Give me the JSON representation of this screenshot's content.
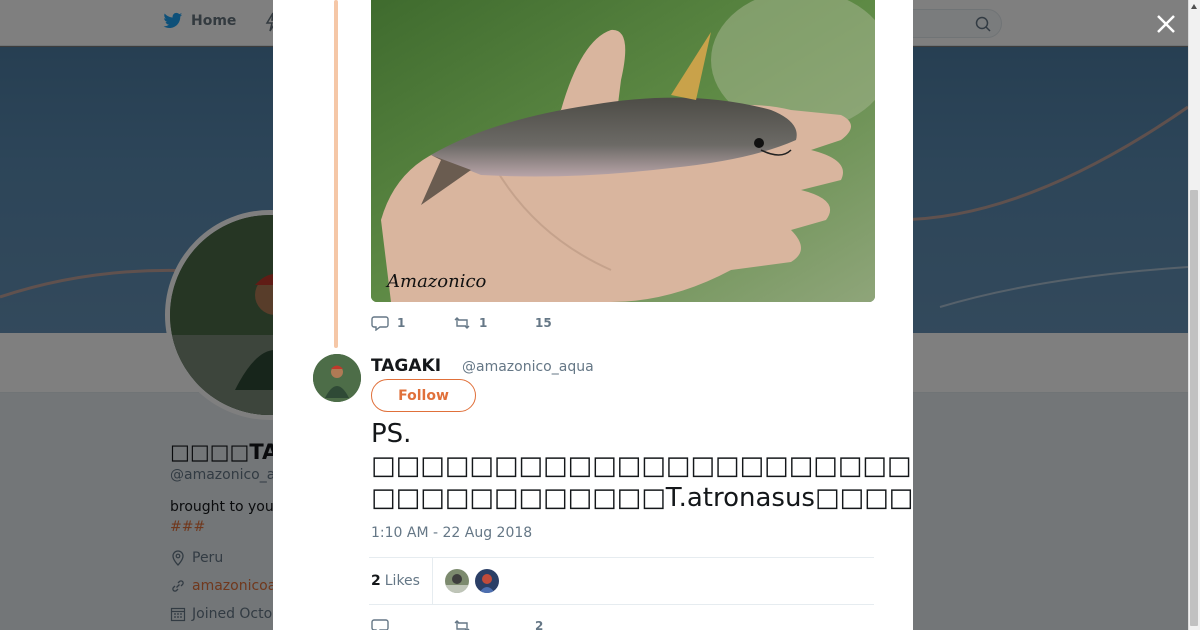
{
  "nav": {
    "home_label": "Home",
    "search_placeholder": ""
  },
  "profile": {
    "display_name": "□□□□TAGA",
    "handle": "@amazonico_a",
    "bio": "brought to you",
    "hashtags": "###",
    "location": "Peru",
    "website": "amazonicoa",
    "joined": "Joined Octo"
  },
  "tweet": {
    "previous_actions": {
      "replies": "1",
      "retweets": "1",
      "likes": "15"
    },
    "author_name": "TAGAKI",
    "author_handle": "@amazonico_aqua",
    "follow_label": "Follow",
    "photo_watermark": "Amazonico",
    "text_lines": [
      "PS.",
      "□□□□□□□□□□□□□□□□□□□□□□□□□□□□□□",
      "□□□□□□□□□□□□T.atronasus□□□□□□□□□□□□□□□□T.cryptica □□□"
    ],
    "timestamp": "1:10 AM - 22 Aug 2018",
    "likes_count": "2",
    "likes_label": "Likes",
    "bottom_actions": {
      "replies": "",
      "retweets": "",
      "likes": "2"
    }
  },
  "colors": {
    "accent": "#e0703a",
    "thread_line": "#f5c7a7",
    "text": "#14171a",
    "muted": "#657786"
  }
}
